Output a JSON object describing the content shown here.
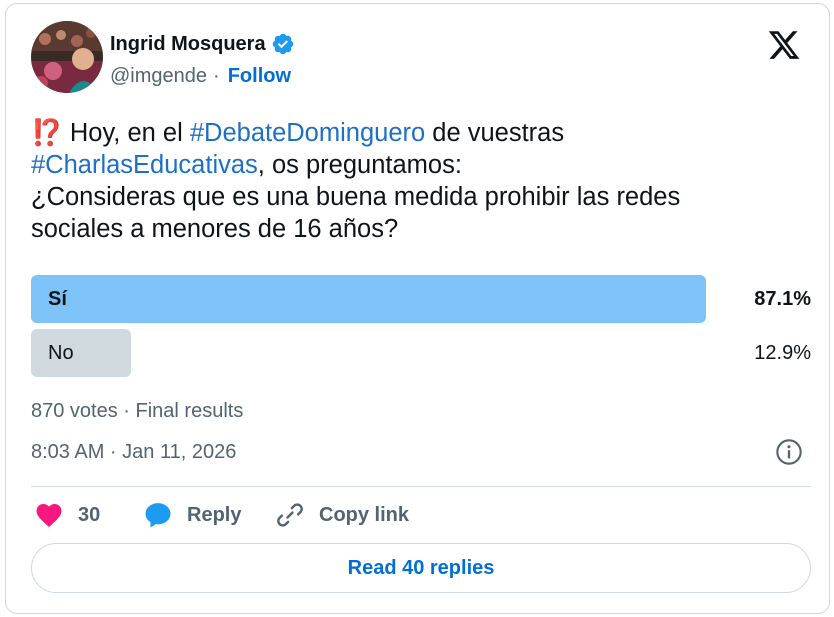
{
  "author": {
    "name": "Ingrid Mosquera",
    "handle": "@imgende",
    "separator": "·",
    "follow_label": "Follow"
  },
  "tweet": {
    "emoji": "⁉️",
    "part1": " Hoy, en el ",
    "hashtag1": "#DebateDominguero",
    "part2": " de vuestras",
    "hashtag2": "#CharlasEducativas",
    "part3": ", os preguntamos:",
    "line3": "¿Consideras que es una buena medida prohibir las redes",
    "line4": "sociales a menores de 16 años?"
  },
  "poll": {
    "options": [
      {
        "label": "Sí",
        "percent": "87.1%",
        "fraction": 0.871,
        "winner": true
      },
      {
        "label": "No",
        "percent": "12.9%",
        "fraction": 0.129,
        "winner": false
      }
    ],
    "summary": "870 votes · Final results"
  },
  "timestamp": "8:03 AM · Jan 11, 2026",
  "actions": {
    "likes": "30",
    "reply_label": "Reply",
    "copy_link_label": "Copy link"
  },
  "read_replies_label": "Read 40 replies",
  "colors": {
    "winner_bar": "#7dc3f7",
    "other_bar": "#cfd9de",
    "link": "#1d6fc7",
    "heart": "#f91880",
    "reply_bubble": "#1d9bf0"
  },
  "icons": [
    "avatar",
    "verified-badge-icon",
    "x-logo-icon",
    "info-icon",
    "heart-icon",
    "reply-icon",
    "link-icon"
  ]
}
